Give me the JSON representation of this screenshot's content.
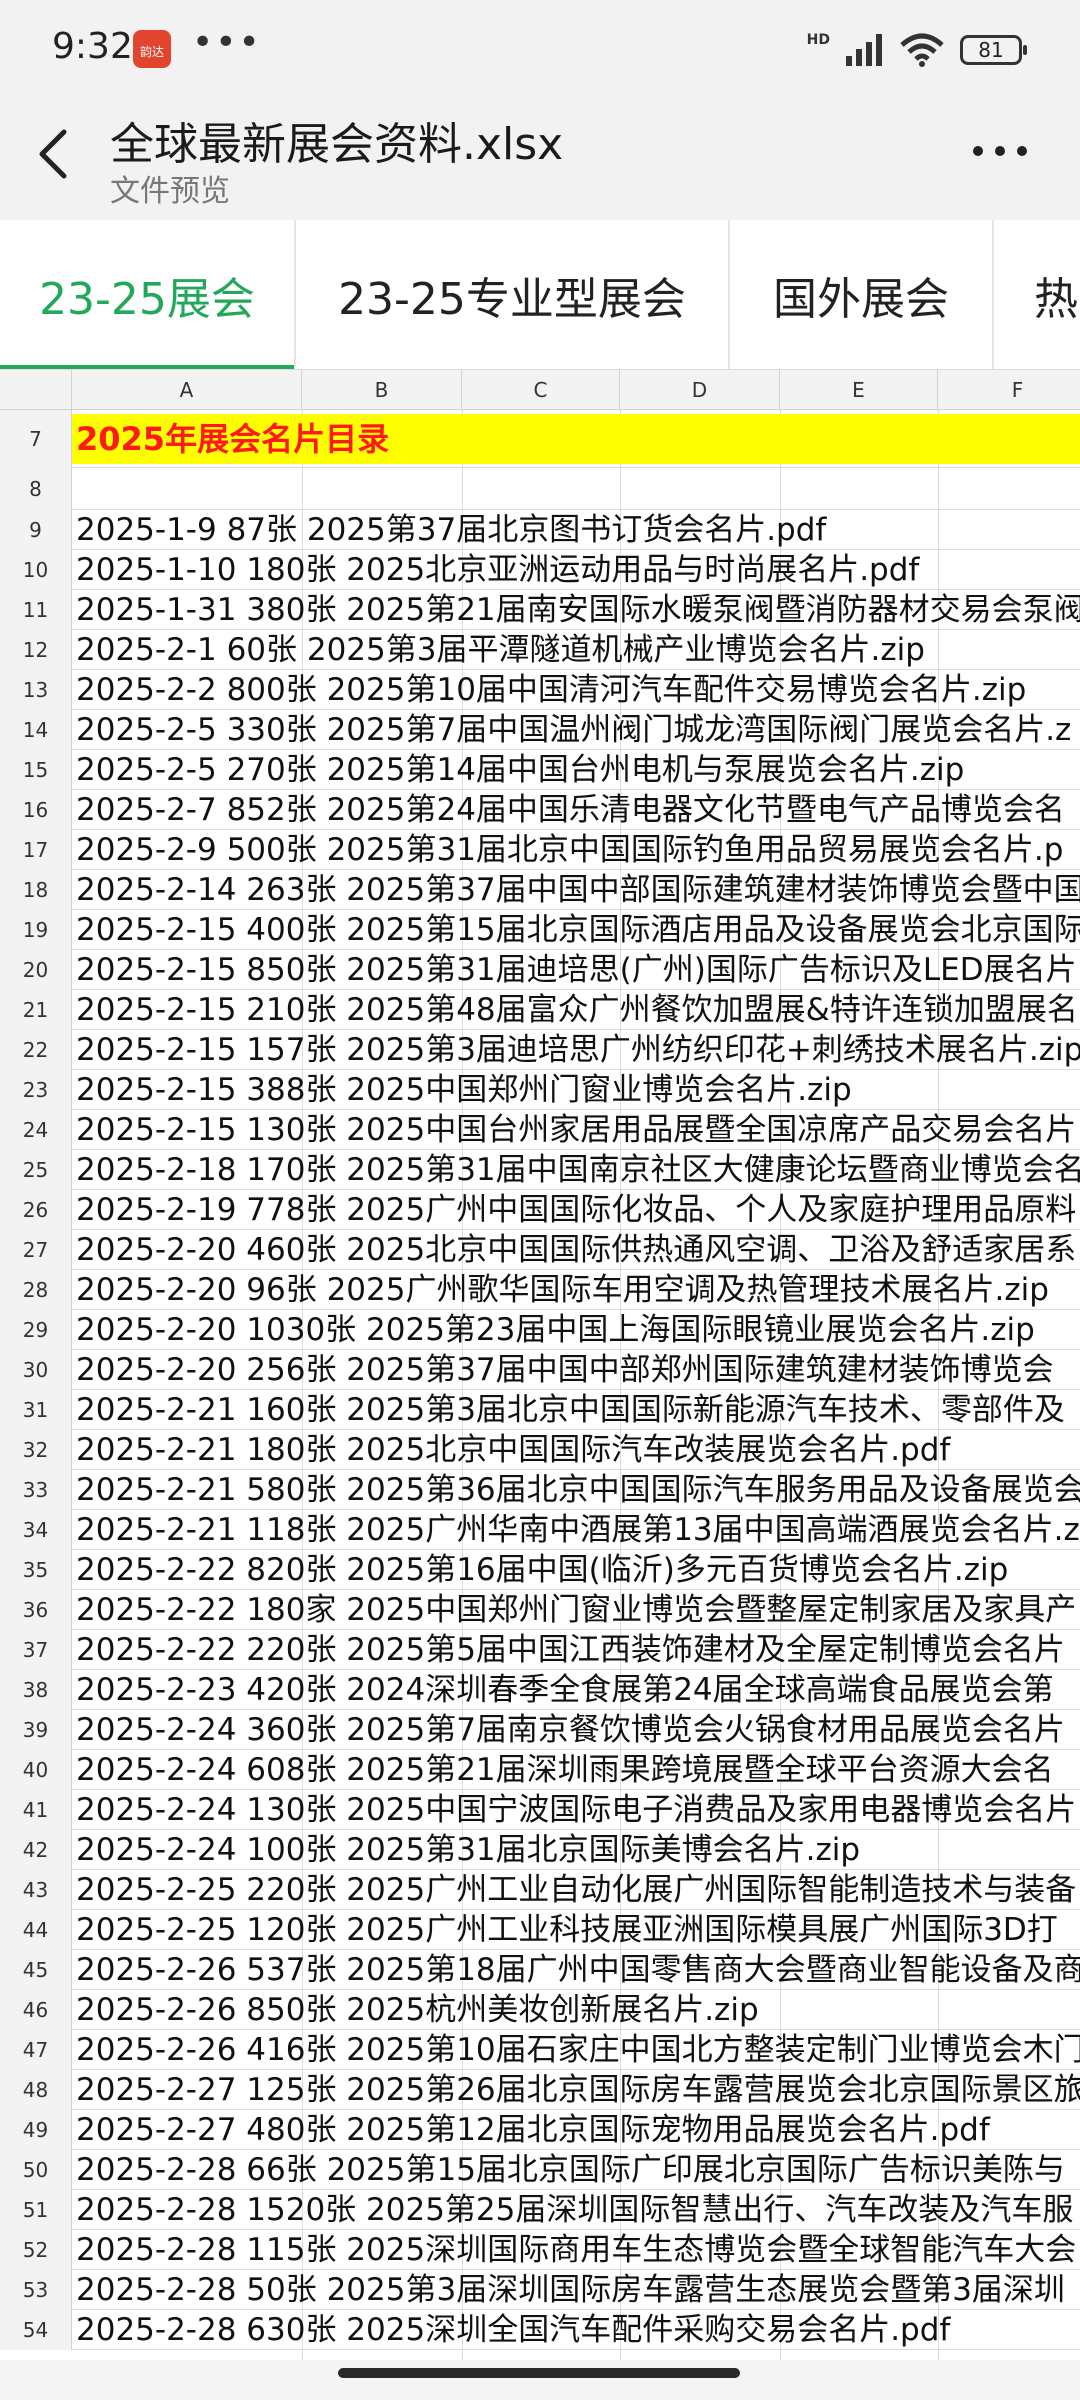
{
  "status": {
    "time": "9:32",
    "badge": "韵达",
    "dots": "•••",
    "net": "HD",
    "battery": "81"
  },
  "header": {
    "title": "全球最新展会资料.xlsx",
    "subtitle": "文件预览"
  },
  "tabs": [
    {
      "label": "23-25展会",
      "active": true
    },
    {
      "label": "23-25专业型展会",
      "active": false
    },
    {
      "label": "国外展会",
      "active": false
    },
    {
      "label": "热",
      "active": false
    }
  ],
  "columns": [
    "A",
    "B",
    "C",
    "D",
    "E",
    "F"
  ],
  "sheet_title": {
    "row": "7",
    "text": "2025年展会名片目录"
  },
  "blank_row": "8",
  "rows": [
    {
      "n": "9",
      "text": "2025-1-9 87张 2025第37届北京图书订货会名片.pdf"
    },
    {
      "n": "10",
      "text": "2025-1-10 180张 2025北京亚洲运动用品与时尚展名片.pdf"
    },
    {
      "n": "11",
      "text": "2025-1-31 380张 2025第21届南安国际水暖泵阀暨消防器材交易会泵阀"
    },
    {
      "n": "12",
      "text": "2025-2-1 60张 2025第3届平潭隧道机械产业博览会名片.zip"
    },
    {
      "n": "13",
      "text": "2025-2-2 800张 2025第10届中国清河汽车配件交易博览会名片.zip"
    },
    {
      "n": "14",
      "text": "2025-2-5 330张 2025第7届中国温州阀门城龙湾国际阀门展览会名片.z"
    },
    {
      "n": "15",
      "text": "2025-2-5 270张 2025第14届中国台州电机与泵展览会名片.zip"
    },
    {
      "n": "16",
      "text": "2025-2-7 852张 2025第24届中国乐清电器文化节暨电气产品博览会名"
    },
    {
      "n": "17",
      "text": "2025-2-9 500张 2025第31届北京中国国际钓鱼用品贸易展览会名片.p"
    },
    {
      "n": "18",
      "text": "2025-2-14 263张 2025第37届中国中部国际建筑建材装饰博览会暨中国"
    },
    {
      "n": "19",
      "text": "2025-2-15 400张 2025第15届北京国际酒店用品及设备展览会北京国际"
    },
    {
      "n": "20",
      "text": "2025-2-15 850张 2025第31届迪培思(广州)国际广告标识及LED展名片"
    },
    {
      "n": "21",
      "text": "2025-2-15 210张 2025第48届富众广州餐饮加盟展&特许连锁加盟展名"
    },
    {
      "n": "22",
      "text": "2025-2-15 157张 2025第3届迪培思广州纺织印花+刺绣技术展名片.zip"
    },
    {
      "n": "23",
      "text": "2025-2-15 388张 2025中国郑州门窗业博览会名片.zip"
    },
    {
      "n": "24",
      "text": "2025-2-15 130张 2025中国台州家居用品展暨全国凉席产品交易会名片"
    },
    {
      "n": "25",
      "text": "2025-2-18 170张 2025第31届中国南京社区大健康论坛暨商业博览会名"
    },
    {
      "n": "26",
      "text": "2025-2-19 778张 2025广州中国国际化妆品、个人及家庭护理用品原料"
    },
    {
      "n": "27",
      "text": "2025-2-20 460张 2025北京中国国际供热通风空调、卫浴及舒适家居系"
    },
    {
      "n": "28",
      "text": "2025-2-20 96张 2025广州歌华国际车用空调及热管理技术展名片.zip"
    },
    {
      "n": "29",
      "text": "2025-2-20 1030张 2025第23届中国上海国际眼镜业展览会名片.zip"
    },
    {
      "n": "30",
      "text": "2025-2-20 256张 2025第37届中国中部郑州国际建筑建材装饰博览会"
    },
    {
      "n": "31",
      "text": "2025-2-21 160张 2025第3届北京中国国际新能源汽车技术、零部件及"
    },
    {
      "n": "32",
      "text": "2025-2-21 180张 2025北京中国国际汽车改装展览会名片.pdf"
    },
    {
      "n": "33",
      "text": "2025-2-21 580张 2025第36届北京中国国际汽车服务用品及设备展览会"
    },
    {
      "n": "34",
      "text": "2025-2-21 118张 2025广州华南中酒展第13届中国高端酒展览会名片.z"
    },
    {
      "n": "35",
      "text": "2025-2-22 820张 2025第16届中国(临沂)多元百货博览会名片.zip"
    },
    {
      "n": "36",
      "text": "2025-2-22 180家 2025中国郑州门窗业博览会暨整屋定制家居及家具产"
    },
    {
      "n": "37",
      "text": "2025-2-22 220张 2025第5届中国江西装饰建材及全屋定制博览会名片"
    },
    {
      "n": "38",
      "text": "2025-2-23 420张 2024深圳春季全食展第24届全球高端食品展览会第"
    },
    {
      "n": "39",
      "text": "2025-2-24 360张 2025第7届南京餐饮博览会火锅食材用品展览会名片"
    },
    {
      "n": "40",
      "text": "2025-2-24 608张 2025第21届深圳雨果跨境展暨全球平台资源大会名"
    },
    {
      "n": "41",
      "text": "2025-2-24 130张 2025中国宁波国际电子消费品及家用电器博览会名片"
    },
    {
      "n": "42",
      "text": "2025-2-24 100张 2025第31届北京国际美博会名片.zip"
    },
    {
      "n": "43",
      "text": "2025-2-25 220张 2025广州工业自动化展广州国际智能制造技术与装备"
    },
    {
      "n": "44",
      "text": "2025-2-25 120张 2025广州工业科技展亚洲国际模具展广州国际3D打"
    },
    {
      "n": "45",
      "text": "2025-2-26 537张 2025第18届广州中国零售商大会暨商业智能设备及商"
    },
    {
      "n": "46",
      "text": "2025-2-26 850张 2025杭州美妆创新展名片.zip"
    },
    {
      "n": "47",
      "text": "2025-2-26 416张 2025第10届石家庄中国北方整装定制门业博览会木门"
    },
    {
      "n": "48",
      "text": "2025-2-27 125张 2025第26届北京国际房车露营展览会北京国际景区旅"
    },
    {
      "n": "49",
      "text": "2025-2-27 480张 2025第12届北京国际宠物用品展览会名片.pdf"
    },
    {
      "n": "50",
      "text": "2025-2-28 66张 2025第15届北京国际广印展北京国际广告标识美陈与"
    },
    {
      "n": "51",
      "text": "2025-2-28 1520张 2025第25届深圳国际智慧出行、汽车改装及汽车服"
    },
    {
      "n": "52",
      "text": "2025-2-28 115张 2025深圳国际商用车生态博览会暨全球智能汽车大会"
    },
    {
      "n": "53",
      "text": "2025-2-28 50张 2025第3届深圳国际房车露营生态展览会暨第3届深圳"
    },
    {
      "n": "54",
      "text": "2025-2-28 630张 2025深圳全国汽车配件采购交易会名片.pdf"
    }
  ]
}
